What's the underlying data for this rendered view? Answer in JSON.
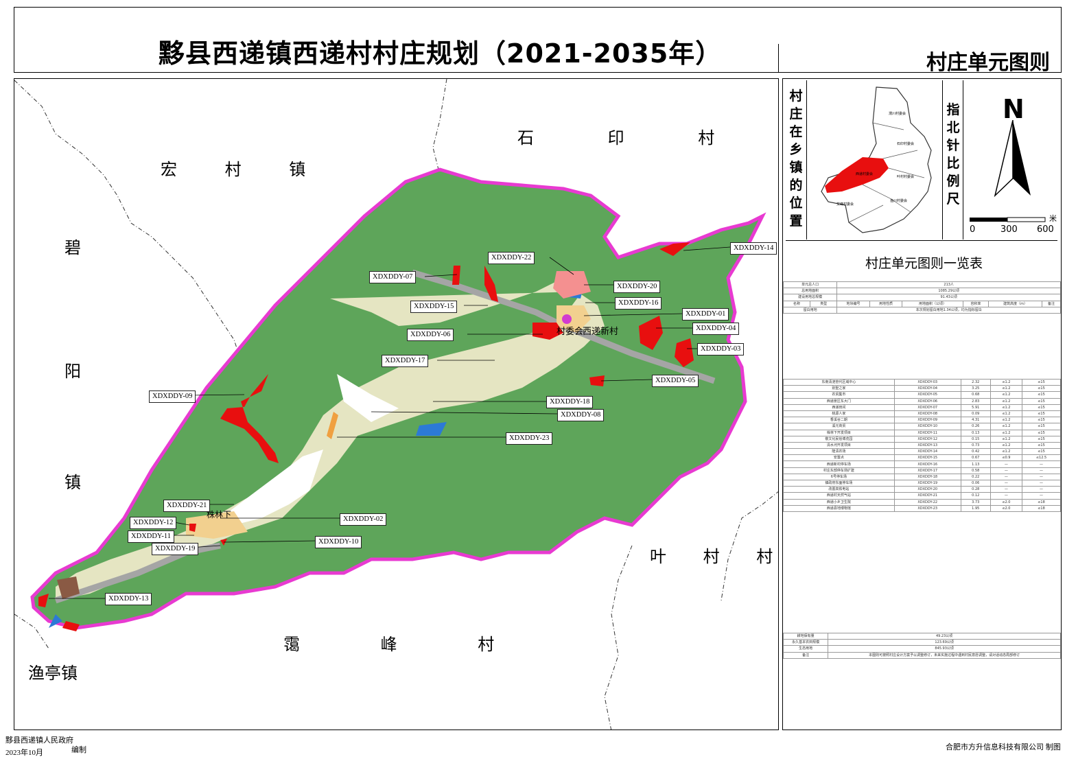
{
  "title": "黟县西递镇西递村村庄规划（2021-2035年）",
  "subtitle": "村庄单元图则",
  "neighbors": {
    "hongcun": "宏 村 镇",
    "shiyin": "石 印 村",
    "biyang_1": "碧",
    "biyang_2": "阳",
    "biyang_3": "镇",
    "yecun": "叶 村 村",
    "lifeng": "霭 峰 村",
    "yuting": "渔亭镇"
  },
  "place_names": {
    "village_committee": "村委会",
    "xidi_new_village": "西递新村",
    "zhulinxia": "株林下"
  },
  "units": [
    "XDXDDY-22",
    "XDXDDY-07",
    "XDXDDY-15",
    "XDXDDY-20",
    "XDXDDY-16",
    "XDXDDY-01",
    "XDXDDY-04",
    "XDXDDY-06",
    "XDXDDY-03",
    "XDXDDY-17",
    "XDXDDY-05",
    "XDXDDY-14",
    "XDXDDY-09",
    "XDXDDY-18",
    "XDXDDY-08",
    "XDXDDY-23",
    "XDXDDY-21",
    "XDXDDY-12",
    "XDXDDY-02",
    "XDXDDY-11",
    "XDXDDY-10",
    "XDXDDY-19",
    "XDXDDY-13"
  ],
  "locator": {
    "heading": "村庄在乡镇的位置",
    "towns": [
      "渭川村委会",
      "石印村委会",
      "西递村委会",
      "叶村村委会",
      "霭峰村委会",
      "渔川村委会",
      "艾峰村委会"
    ]
  },
  "compass": {
    "heading": "指北针比例尺",
    "north": "N",
    "scale_unit": "米",
    "scale_ticks": [
      "0",
      "300",
      "600"
    ]
  },
  "table": {
    "heading": "村庄单元图则一览表",
    "population_label": "单元总人口",
    "population_value": "213人",
    "area_label": "总用地面积",
    "area_value": "1085.29公顷",
    "construction_label": "建设用地总规模",
    "construction_value": "91.43公顷",
    "header_cols": [
      "名称",
      "类型",
      "地块编号",
      "用地性质",
      "用地面积（公顷）",
      "容积率",
      "建筑高度（m）",
      "备注"
    ],
    "reserve_label": "留白用地",
    "reserve_value": "本次规划留白用地1.34公顷，均为指标留白",
    "rows": [
      [
        "东南清涟管代区域中心",
        "XDXDDY-03",
        "2.32",
        "≤1.2",
        "≤15"
      ],
      [
        "别墅之家",
        "XDXDDY-04",
        "3.25",
        "≤1.2",
        "≤15"
      ],
      [
        "农贸集市",
        "XDXDDY-05",
        "0.68",
        "≤1.2",
        "≤15"
      ],
      [
        "西递景区东大门",
        "XDXDDY-06",
        "2.83",
        "≤1.2",
        "≤15"
      ],
      [
        "西递田间",
        "XDXDDY-07",
        "5.91",
        "≤1.2",
        "≤15"
      ],
      [
        "桃源人家",
        "XDXDDY-08",
        "0.09",
        "≤1.2",
        "≤15"
      ],
      [
        "香溪谷二期",
        "XDXDDY-09",
        "4.31",
        "≤1.2",
        "≤15"
      ],
      [
        "溪元商贸",
        "XDXDDY-10",
        "0.26",
        "≤1.2",
        "≤15"
      ],
      [
        "株林下开发项目",
        "XDXDDY-11",
        "0.13",
        "≤1.2",
        "≤15"
      ],
      [
        "敬文化民俗博览园",
        "XDXDDY-12",
        "0.15",
        "≤1.2",
        "≤15"
      ],
      [
        "清水河开发项目",
        "XDXDDY-13",
        "0.73",
        "≤1.2",
        "≤15"
      ],
      [
        "隆清农场",
        "XDXDDY-14",
        "0.42",
        "≤1.2",
        "≤15"
      ],
      [
        "安置点",
        "XDXDDY-15",
        "0.67",
        "≤0.9",
        "≤12.5"
      ],
      [
        "西递新村停车场",
        "XDXDDY-16",
        "1.13",
        "—",
        "—"
      ],
      [
        "村庄东部停车场扩建",
        "XDXDDY-17",
        "0.58",
        "—",
        "—"
      ],
      [
        "6号停车场",
        "XDXDDY-18",
        "0.22",
        "—",
        "—"
      ],
      [
        "镇政府东面停车场",
        "XDXDDY-19",
        "0.06",
        "—",
        "—"
      ],
      [
        "改置高铁电站",
        "XDXDDY-20",
        "0.28",
        "—",
        "—"
      ],
      [
        "西递村天然气站",
        "XDXDDY-21",
        "0.12",
        "—",
        "—"
      ],
      [
        "西递小乡卫生院",
        "XDXDDY-22",
        "3.73",
        "≤2.0",
        "≤18"
      ],
      [
        "西递县地博物馆",
        "XDXDDY-23",
        "1.95",
        "≤2.0",
        "≤18"
      ]
    ],
    "farmland_label": "耕地保有量",
    "farmland_value": "49.23公顷",
    "basic_farm_label": "永久基本农田规模",
    "basic_farm_value": "123.69公顷",
    "eco_label": "生态用地",
    "forest_label": "面积",
    "forest_value": "845.93公顷",
    "note_label": "备注",
    "note_value": "本图则可按照村庄设计方案予以调整修订，未来实施过程中遇到村民意愿调整，请对话动态局部修订"
  },
  "footer": {
    "gov": "黟县西递镇人民政府",
    "date": "2023年10月",
    "edit": "编制",
    "maker": "合肥市方升信息科技有限公司  制图"
  },
  "colors": {
    "greenland": "#5ea55a",
    "boundary": "#e83ad1",
    "commercial": "#e80f0f",
    "road": "#a5a5a5",
    "water": "#2c7ad6",
    "settlement": "#f2d08f"
  }
}
